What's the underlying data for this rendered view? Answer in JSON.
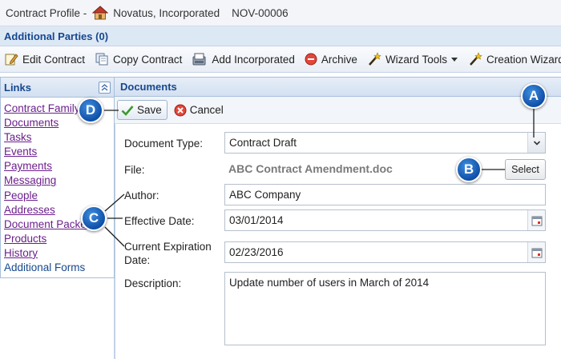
{
  "titlebar": {
    "label": "Contract Profile -",
    "company": "Novatus, Incorporated",
    "contract_id": "NOV-00006"
  },
  "parties": {
    "label": "Additional Parties (0)"
  },
  "toolbar": {
    "edit_contract": "Edit Contract",
    "copy_contract": "Copy Contract",
    "add_incorporated": "Add Incorporated",
    "archive": "Archive",
    "wizard_tools": "Wizard Tools",
    "creation_wizard": "Creation Wizard"
  },
  "links": {
    "title": "Links",
    "items": [
      "Contract Family",
      "Documents",
      "Tasks",
      "Events",
      "Payments",
      "Messaging",
      "People",
      "Addresses",
      "Document Packets",
      "Products",
      "History",
      "Additional Forms"
    ]
  },
  "documents": {
    "title": "Documents",
    "save": "Save",
    "cancel": "Cancel",
    "document_type_label": "Document Type:",
    "document_type_value": "Contract Draft",
    "file_label": "File:",
    "file_value": "ABC Contract Amendment.doc",
    "select_button": "Select",
    "author_label": "Author:",
    "author_value": "ABC Company",
    "effective_date_label": "Effective Date:",
    "effective_date_value": "03/01/2014",
    "current_expiration_label_1": "Current Expiration",
    "current_expiration_label_2": "Date:",
    "current_expiration_value": "02/23/2016",
    "description_label": "Description:",
    "description_value": "Update number of users in March of 2014"
  },
  "callouts": {
    "a": "A",
    "b": "B",
    "c": "C",
    "d": "D"
  },
  "colors": {
    "header_text": "#16478e",
    "callout": "#1565c0",
    "visited_link": "#6b1f8c"
  }
}
